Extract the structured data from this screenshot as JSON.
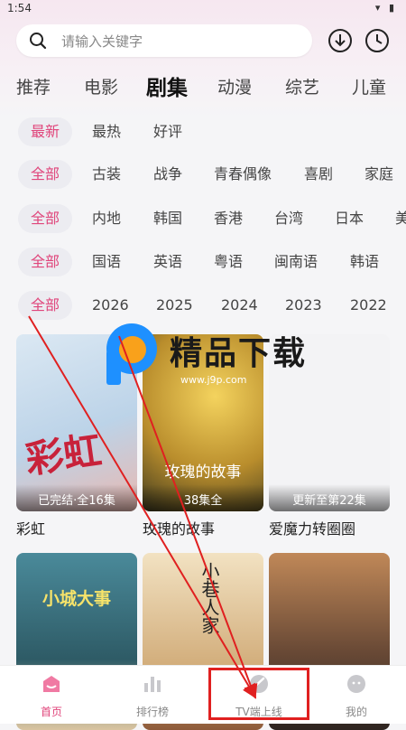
{
  "status": {
    "time": "1:54",
    "icons": "▾ ▮"
  },
  "search": {
    "placeholder": "请输入关键字"
  },
  "categories": [
    "推荐",
    "电影",
    "剧集",
    "动漫",
    "综艺",
    "儿童"
  ],
  "filters": {
    "sort": [
      "最新",
      "最热",
      "好评"
    ],
    "genre": [
      "全部",
      "古装",
      "战争",
      "青春偶像",
      "喜剧",
      "家庭"
    ],
    "region": [
      "全部",
      "内地",
      "韩国",
      "香港",
      "台湾",
      "日本",
      "美"
    ],
    "language": [
      "全部",
      "国语",
      "英语",
      "粤语",
      "闽南语",
      "韩语"
    ],
    "year": [
      "全部",
      "2026",
      "2025",
      "2024",
      "2023",
      "2022"
    ]
  },
  "cards": [
    {
      "title": "彩虹",
      "badge": "已完结·全16集",
      "poster_text": "彩虹",
      "color": "#c6d8e8"
    },
    {
      "title": "玫瑰的故事",
      "badge": "38集全",
      "poster_text": "玫瑰的故事",
      "color": "#b99a3c"
    },
    {
      "title": "爱魔力转圈圈",
      "badge": "更新至第22集",
      "poster_text": "",
      "color": "#f2f2f2"
    },
    {
      "title": "",
      "badge": "",
      "poster_text": "小城大事",
      "color": "#3d6e7c"
    },
    {
      "title": "",
      "badge": "",
      "poster_text": "小巷人家",
      "color": "#d9b98a"
    },
    {
      "title": "",
      "badge": "",
      "poster_text": "",
      "color": "#7a5a44"
    }
  ],
  "nav": [
    {
      "label": "首页",
      "icon": "home-icon"
    },
    {
      "label": "排行榜",
      "icon": "ranking-icon"
    },
    {
      "label": "TV端上线",
      "icon": "tv-icon"
    },
    {
      "label": "我的",
      "icon": "profile-icon"
    }
  ],
  "watermark": {
    "text": "精品下载",
    "url": "www.j9p.com"
  },
  "colors": {
    "accent": "#e0457b",
    "annotation_red": "#e02020"
  }
}
